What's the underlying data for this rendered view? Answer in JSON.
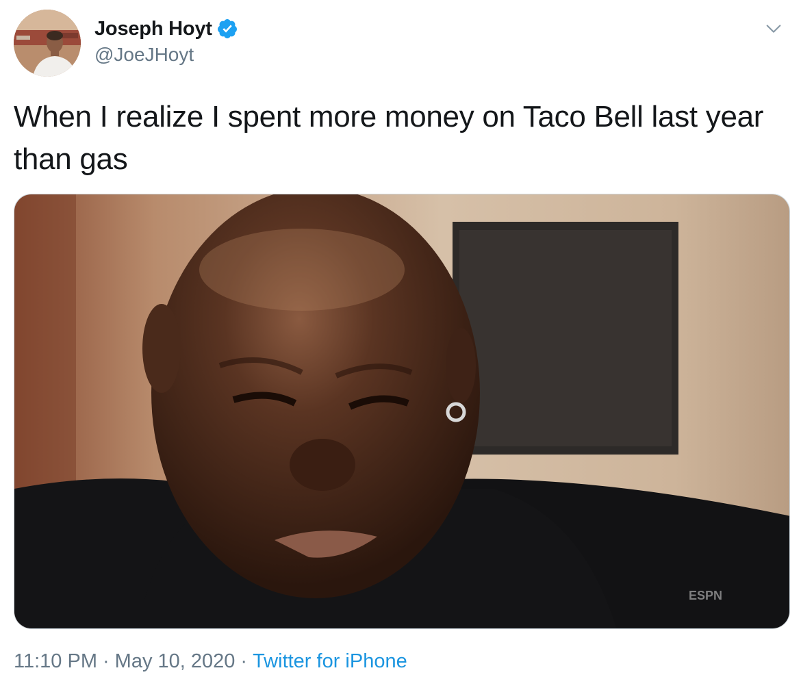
{
  "author": {
    "display_name": "Joseph Hoyt",
    "handle": "@JoeJHoyt",
    "verified": true,
    "verified_color": "#1da1f2"
  },
  "tweet": {
    "text": "When I realize I spent more money on Taco Bell last year than gas",
    "media_watermark": "ESPN"
  },
  "meta": {
    "time": "11:10 PM",
    "separator": "·",
    "date": "May 10, 2020",
    "source": "Twitter for iPhone"
  },
  "icons": {
    "more": "chevron-down-icon",
    "verified": "verified-badge-icon"
  },
  "colors": {
    "text": "#14171a",
    "muted": "#657786",
    "link": "#1b95e0",
    "border": "#ccd6dd"
  }
}
